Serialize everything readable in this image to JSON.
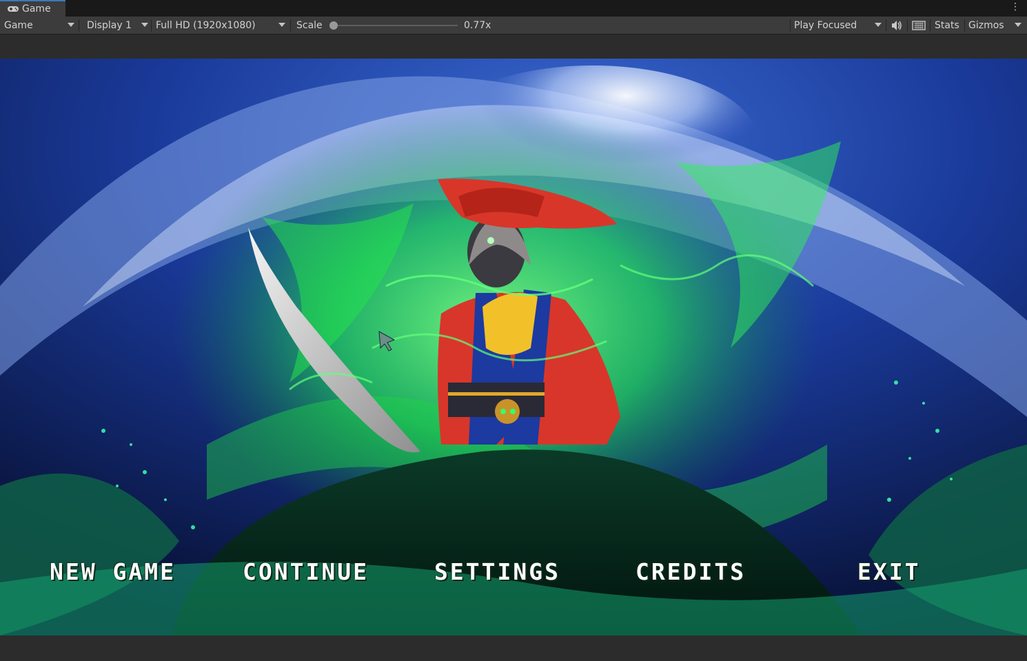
{
  "tab": {
    "title": "Game",
    "icon": "gamepad-icon",
    "more_icon": "kebab-menu-icon"
  },
  "toolbar": {
    "view_dropdown": "Game",
    "display_dropdown": "Display 1",
    "resolution_dropdown": "Full HD (1920x1080)",
    "scale_label": "Scale",
    "scale_value": "0.77x",
    "scale_fraction": 0.0,
    "play_mode_dropdown": "Play Focused",
    "audio_icon": "speaker-icon",
    "keyboard_icon": "keyboard-icon",
    "stats_label": "Stats",
    "gizmos_label": "Gizmos"
  },
  "game_menu": {
    "items": [
      "NEW GAME",
      "CONTINUE",
      "SETTINGS",
      "CREDITS",
      "EXIT"
    ]
  },
  "colors": {
    "editor_bg": "#282828",
    "toolbar_bg": "#3c3c3c",
    "tab_accent": "#3a79bb",
    "glow_green": "#2bff55",
    "sky_blue": "#1c3f9c",
    "menu_text": "#ffffff"
  }
}
